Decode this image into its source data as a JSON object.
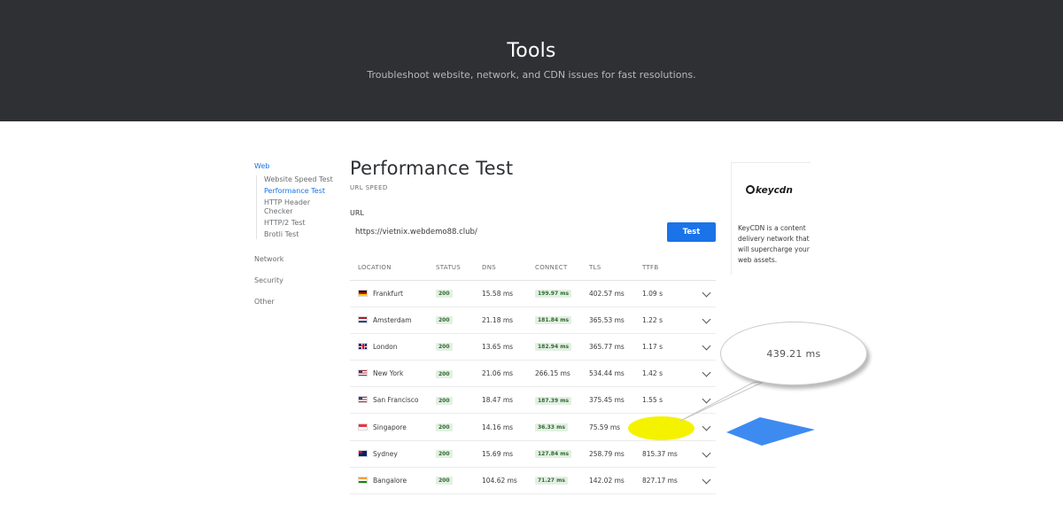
{
  "hero": {
    "title": "Tools",
    "subtitle": "Troubleshoot website, network, and CDN issues for fast resolutions."
  },
  "sidebar": {
    "groups": [
      {
        "label": "Web",
        "active": true,
        "items": [
          {
            "label": "Website Speed Test",
            "active": false
          },
          {
            "label": "Performance Test",
            "active": true
          },
          {
            "label": "HTTP Header Checker",
            "active": false
          },
          {
            "label": "HTTP/2 Test",
            "active": false
          },
          {
            "label": "Brotli Test",
            "active": false
          }
        ]
      },
      {
        "label": "Network"
      },
      {
        "label": "Security"
      },
      {
        "label": "Other"
      }
    ]
  },
  "main": {
    "title": "Performance Test",
    "subtitle": "URL SPEED",
    "url_label": "URL",
    "url_value": "https://vietnix.webdemo88.club/",
    "test_button": "Test"
  },
  "table": {
    "columns": [
      "LOCATION",
      "STATUS",
      "DNS",
      "CONNECT",
      "TLS",
      "TTFB"
    ],
    "rows": [
      {
        "location": "Frankfurt",
        "flag": "de-flag-icon",
        "status": "200",
        "dns": "15.58 ms",
        "connect": "199.97 ms",
        "connect_badge": true,
        "tls": "402.57 ms",
        "ttfb": "1.09 s"
      },
      {
        "location": "Amsterdam",
        "flag": "nl-flag-icon",
        "status": "200",
        "dns": "21.18 ms",
        "connect": "181.84 ms",
        "connect_badge": true,
        "tls": "365.53 ms",
        "ttfb": "1.22 s"
      },
      {
        "location": "London",
        "flag": "uk-flag-icon",
        "status": "200",
        "dns": "13.65 ms",
        "connect": "182.94 ms",
        "connect_badge": true,
        "tls": "365.77 ms",
        "ttfb": "1.17 s"
      },
      {
        "location": "New York",
        "flag": "us-flag-icon",
        "status": "200",
        "dns": "21.06 ms",
        "connect": "266.15 ms",
        "connect_badge": false,
        "tls": "534.44 ms",
        "ttfb": "1.42 s"
      },
      {
        "location": "San Francisco",
        "flag": "us-flag-icon",
        "status": "200",
        "dns": "18.47 ms",
        "connect": "187.39 ms",
        "connect_badge": true,
        "tls": "375.45 ms",
        "ttfb": "1.55 s"
      },
      {
        "location": "Singapore",
        "flag": "sg-flag-icon",
        "status": "200",
        "dns": "14.16 ms",
        "connect": "36.33 ms",
        "connect_badge": true,
        "tls": "75.59 ms",
        "ttfb": "439.21 ms"
      },
      {
        "location": "Sydney",
        "flag": "au-flag-icon",
        "status": "200",
        "dns": "15.69 ms",
        "connect": "127.84 ms",
        "connect_badge": true,
        "tls": "258.79 ms",
        "ttfb": "815.37 ms"
      },
      {
        "location": "Bangalore",
        "flag": "in-flag-icon",
        "status": "200",
        "dns": "104.62 ms",
        "connect": "71.27 ms",
        "connect_badge": true,
        "tls": "142.02 ms",
        "ttfb": "827.17 ms"
      }
    ]
  },
  "annotation": {
    "callout_text": "439.21 ms",
    "highlight_color": "#f5f200",
    "arrow_color": "#3d8bf0"
  },
  "ad": {
    "logo_text": "keycdn",
    "description": "KeyCDN is a content delivery network that will supercharge your web assets."
  },
  "colors": {
    "hero_bg": "#2e3033",
    "accent": "#1a73e8",
    "badge_bg": "#e3efe3"
  }
}
